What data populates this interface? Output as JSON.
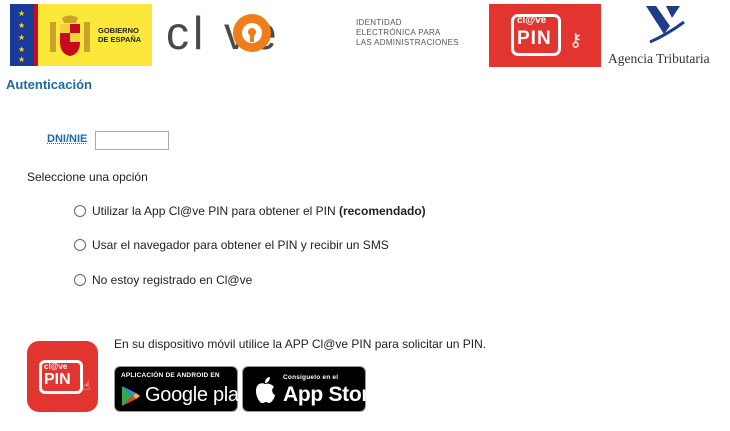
{
  "header": {
    "gov_text_line1": "GOBIERNO",
    "gov_text_line2": "DE ESPAÑA",
    "clave_word": "cl ve",
    "clave_sub_line1": "IDENTIDAD",
    "clave_sub_line2": "ELECTRÓNICA PARA",
    "clave_sub_line3": "LAS ADMINISTRACIONES",
    "pin_logo_top": "cl@ve",
    "pin_logo_pin": "PIN",
    "agencia_text": "Agencia Tributaria"
  },
  "form": {
    "title": "Autenticación",
    "dni_label": "DNI/NIE",
    "dni_value": "",
    "select_label": "Seleccione una opción",
    "options": [
      {
        "text": "Utilizar la App Cl@ve PIN para obtener el PIN ",
        "bold": "(recomendado)"
      },
      {
        "text": "Usar el navegador para obtener el PIN y recibir un SMS",
        "bold": ""
      },
      {
        "text": "No estoy registrado en Cl@ve",
        "bold": ""
      }
    ]
  },
  "app": {
    "icon_top": "cl@ve",
    "icon_pin": "PIN",
    "message": "En su dispositivo móvil utilice la APP Cl@ve PIN para solicitar un PIN.",
    "google_small": "APLICACIÓN DE ANDROID EN",
    "google_big": "Google play",
    "apple_small": "Consíguelo en el",
    "apple_big": "App Store"
  },
  "colors": {
    "title_blue": "#1c6aa8",
    "clave_orange": "#f07d1a",
    "pin_red": "#e2352f"
  }
}
